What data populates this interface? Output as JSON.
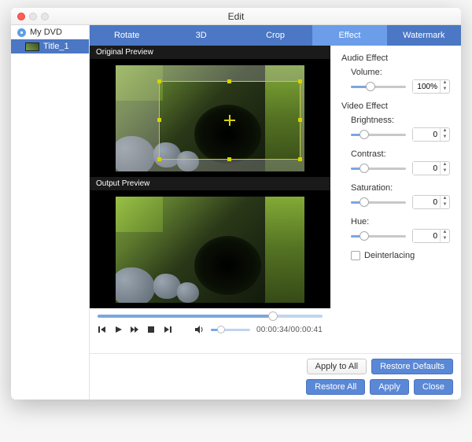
{
  "window": {
    "title": "Edit"
  },
  "sidebar": {
    "root": "My DVD",
    "item": "Title_1"
  },
  "tabs": [
    "Rotate",
    "3D",
    "Crop",
    "Effect",
    "Watermark"
  ],
  "active_tab_index": 3,
  "previews": {
    "original_label": "Original Preview",
    "output_label": "Output Preview"
  },
  "player": {
    "progress_percent": 78,
    "volume_percent": 25,
    "time": "00:00:34/00:00:41"
  },
  "effects": {
    "audio_title": "Audio Effect",
    "volume": {
      "label": "Volume:",
      "value": "100%",
      "percent": 35
    },
    "video_title": "Video Effect",
    "brightness": {
      "label": "Brightness:",
      "value": "0",
      "percent": 24
    },
    "contrast": {
      "label": "Contrast:",
      "value": "0",
      "percent": 24
    },
    "saturation": {
      "label": "Saturation:",
      "value": "0",
      "percent": 24
    },
    "hue": {
      "label": "Hue:",
      "value": "0",
      "percent": 24
    },
    "deinterlacing": {
      "label": "Deinterlacing",
      "checked": false
    }
  },
  "buttons": {
    "apply_to_all": "Apply to All",
    "restore_defaults": "Restore Defaults",
    "restore_all": "Restore All",
    "apply": "Apply",
    "close": "Close"
  }
}
